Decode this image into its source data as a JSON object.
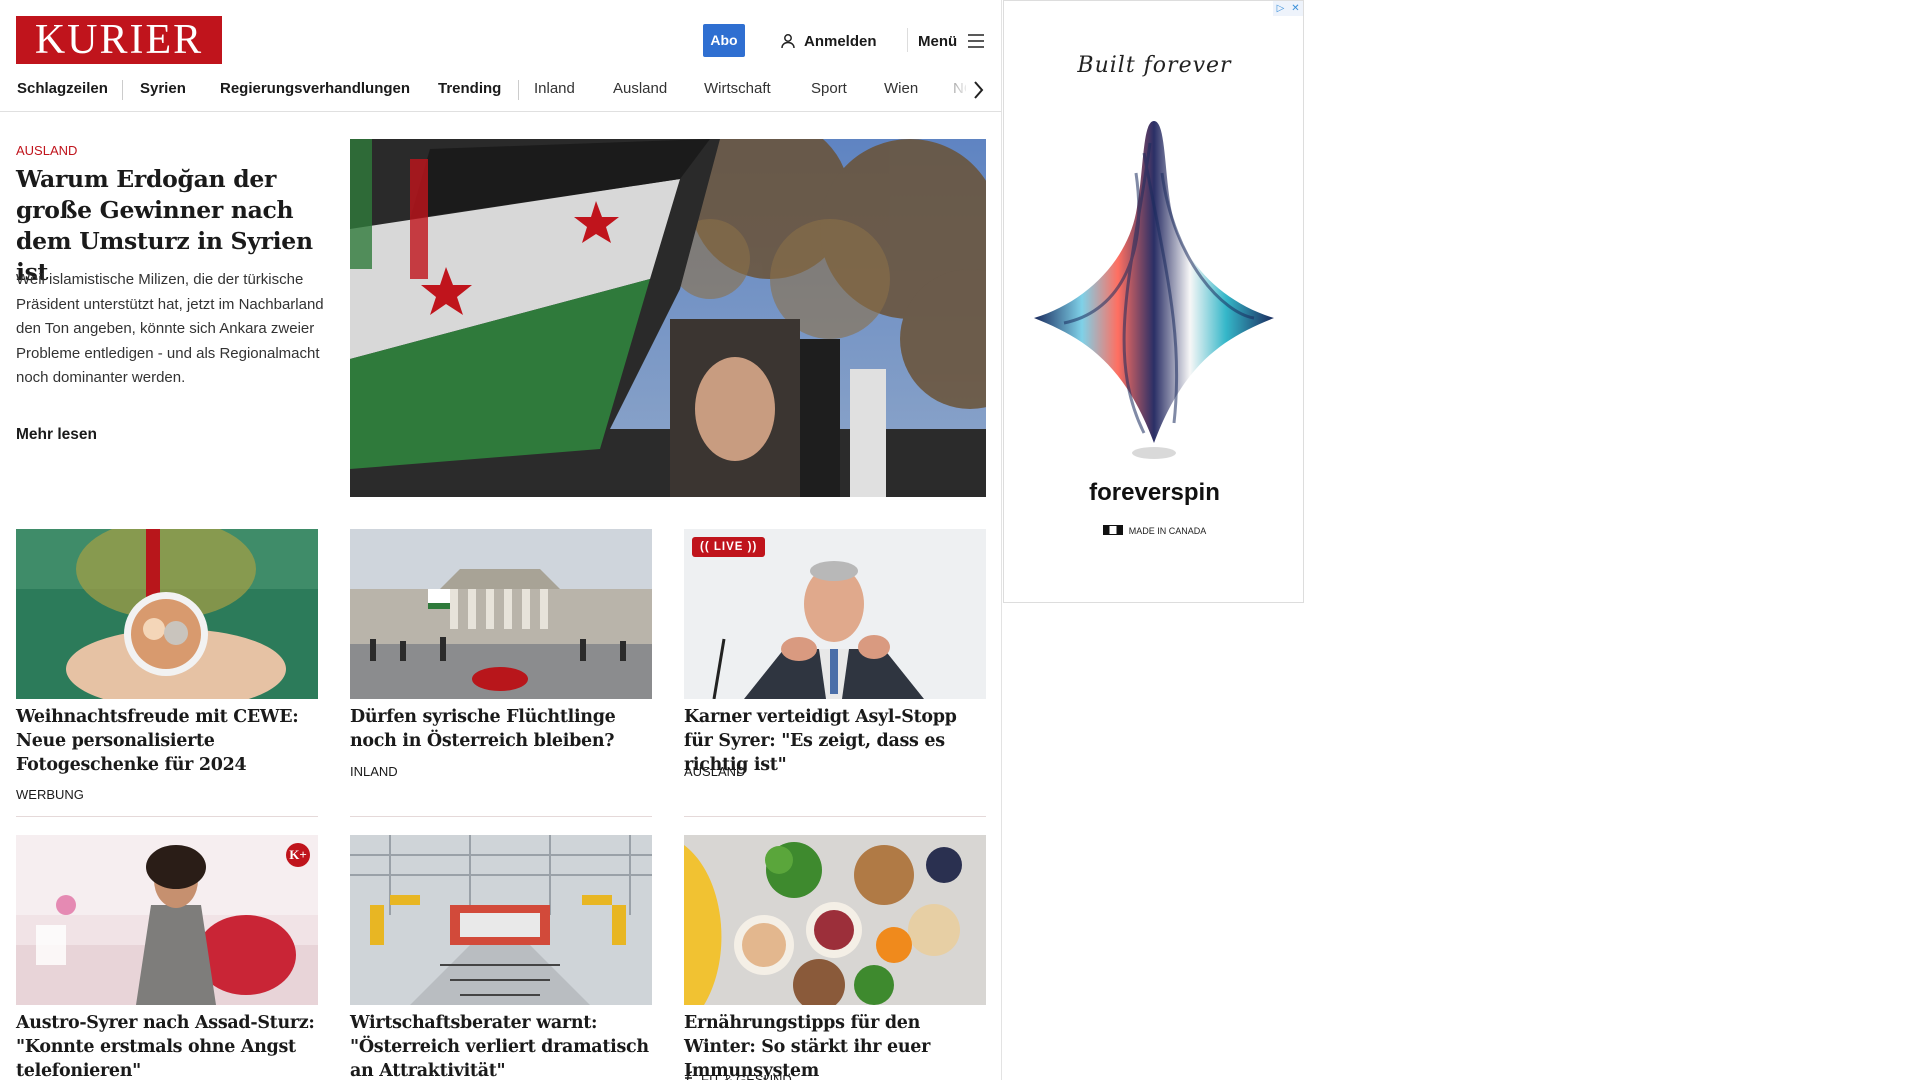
{
  "brand": {
    "logo_text": "KURIER",
    "color": "#c0141c"
  },
  "header": {
    "abo_label": "Abo",
    "login_label": "Anmelden",
    "menu_label": "Menü"
  },
  "nav": {
    "items": [
      "Schlagzeilen",
      "Syrien",
      "Regierungsverhandlungen",
      "Trending",
      "Inland",
      "Ausland",
      "Wirtschaft",
      "Sport",
      "Wien",
      "NÖ"
    ]
  },
  "lead": {
    "category": "AUSLAND",
    "title": "Warum Erdoğan der große Gewinner nach dem Umsturz in Syrien ist",
    "text": "Weil islamistische Milizen, die der türkische Präsident unterstützt hat, jetzt im Nachbarland den Ton angeben, könnte sich Ankara zweier Probleme entledigen - und als Regionalmacht noch dominanter werden.",
    "more": "Mehr lesen"
  },
  "cards": [
    {
      "title": "Weihnachtsfreude mit CEWE: Neue personalisierte Fotogeschenke für 2024",
      "category": "WERBUNG"
    },
    {
      "title": "Dürfen syrische Flüchtlinge noch in Österreich bleiben?",
      "category": "INLAND"
    },
    {
      "title": "Karner verteidigt Asyl-Stopp für Syrer: \"Es zeigt, dass es richtig ist\"",
      "category": "AUSLAND",
      "badge": "LIVE"
    },
    {
      "title": "Austro-Syrer nach Assad-Sturz: \"Konnte erstmals ohne Angst telefonieren\"",
      "category": ""
    },
    {
      "title": "Wirtschaftsberater warnt: \"Öster­reich verliert dramatisch an Attraktivität\"",
      "category": ""
    },
    {
      "title": "Ernährungstipps für den Winter: So stärkt ihr euer Immunsystem",
      "category": "FIT & GESUND"
    }
  ],
  "ad": {
    "tagline": "Built forever",
    "brand": "foreverspin",
    "made": "MADE IN CANADA",
    "badge_icons": [
      "adchoices-icon",
      "close-icon"
    ]
  }
}
